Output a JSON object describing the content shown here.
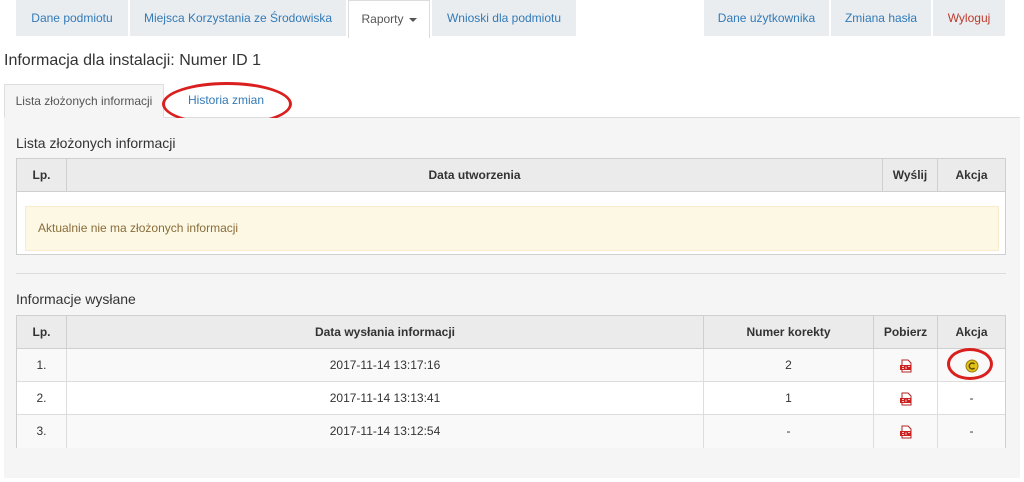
{
  "nav": {
    "left": [
      {
        "label": "Dane podmiotu"
      },
      {
        "label": "Miejsca Korzystania ze Środowiska"
      },
      {
        "label": "Raporty"
      },
      {
        "label": "Wnioski dla podmiotu"
      }
    ],
    "right": [
      {
        "label": "Dane użytkownika"
      },
      {
        "label": "Zmiana hasła"
      },
      {
        "label": "Wyloguj"
      }
    ],
    "active": "Raporty"
  },
  "page": {
    "title": "Informacja dla instalacji: Numer ID 1"
  },
  "tabs": [
    {
      "label": "Lista złożonych informacji",
      "active": true
    },
    {
      "label": "Historia zmian",
      "active": false
    }
  ],
  "submitted": {
    "title": "Lista złożonych informacji",
    "columns": [
      "Lp.",
      "Data utworzenia",
      "Wyślij",
      "Akcja"
    ],
    "empty_message": "Aktualnie nie ma złożonych informacji"
  },
  "sent": {
    "title": "Informacje wysłane",
    "columns": [
      "Lp.",
      "Data wysłania informacji",
      "Numer korekty",
      "Pobierz",
      "Akcja"
    ],
    "rows": [
      {
        "lp": "1.",
        "date": "2017-11-14 13:17:16",
        "correction": "2",
        "download_icon": "pdf-icon",
        "action": "",
        "action_icon": "correction-icon"
      },
      {
        "lp": "2.",
        "date": "2017-11-14 13:13:41",
        "correction": "1",
        "download_icon": "pdf-icon",
        "action": "-"
      },
      {
        "lp": "3.",
        "date": "2017-11-14 13:12:54",
        "correction": "-",
        "download_icon": "pdf-icon",
        "action": "-"
      }
    ]
  },
  "colors": {
    "link": "#337ab7",
    "danger": "#c0392b",
    "highlight": "#d9201f",
    "alert_bg": "#fcf8e3",
    "alert_text": "#8a6d3b"
  }
}
